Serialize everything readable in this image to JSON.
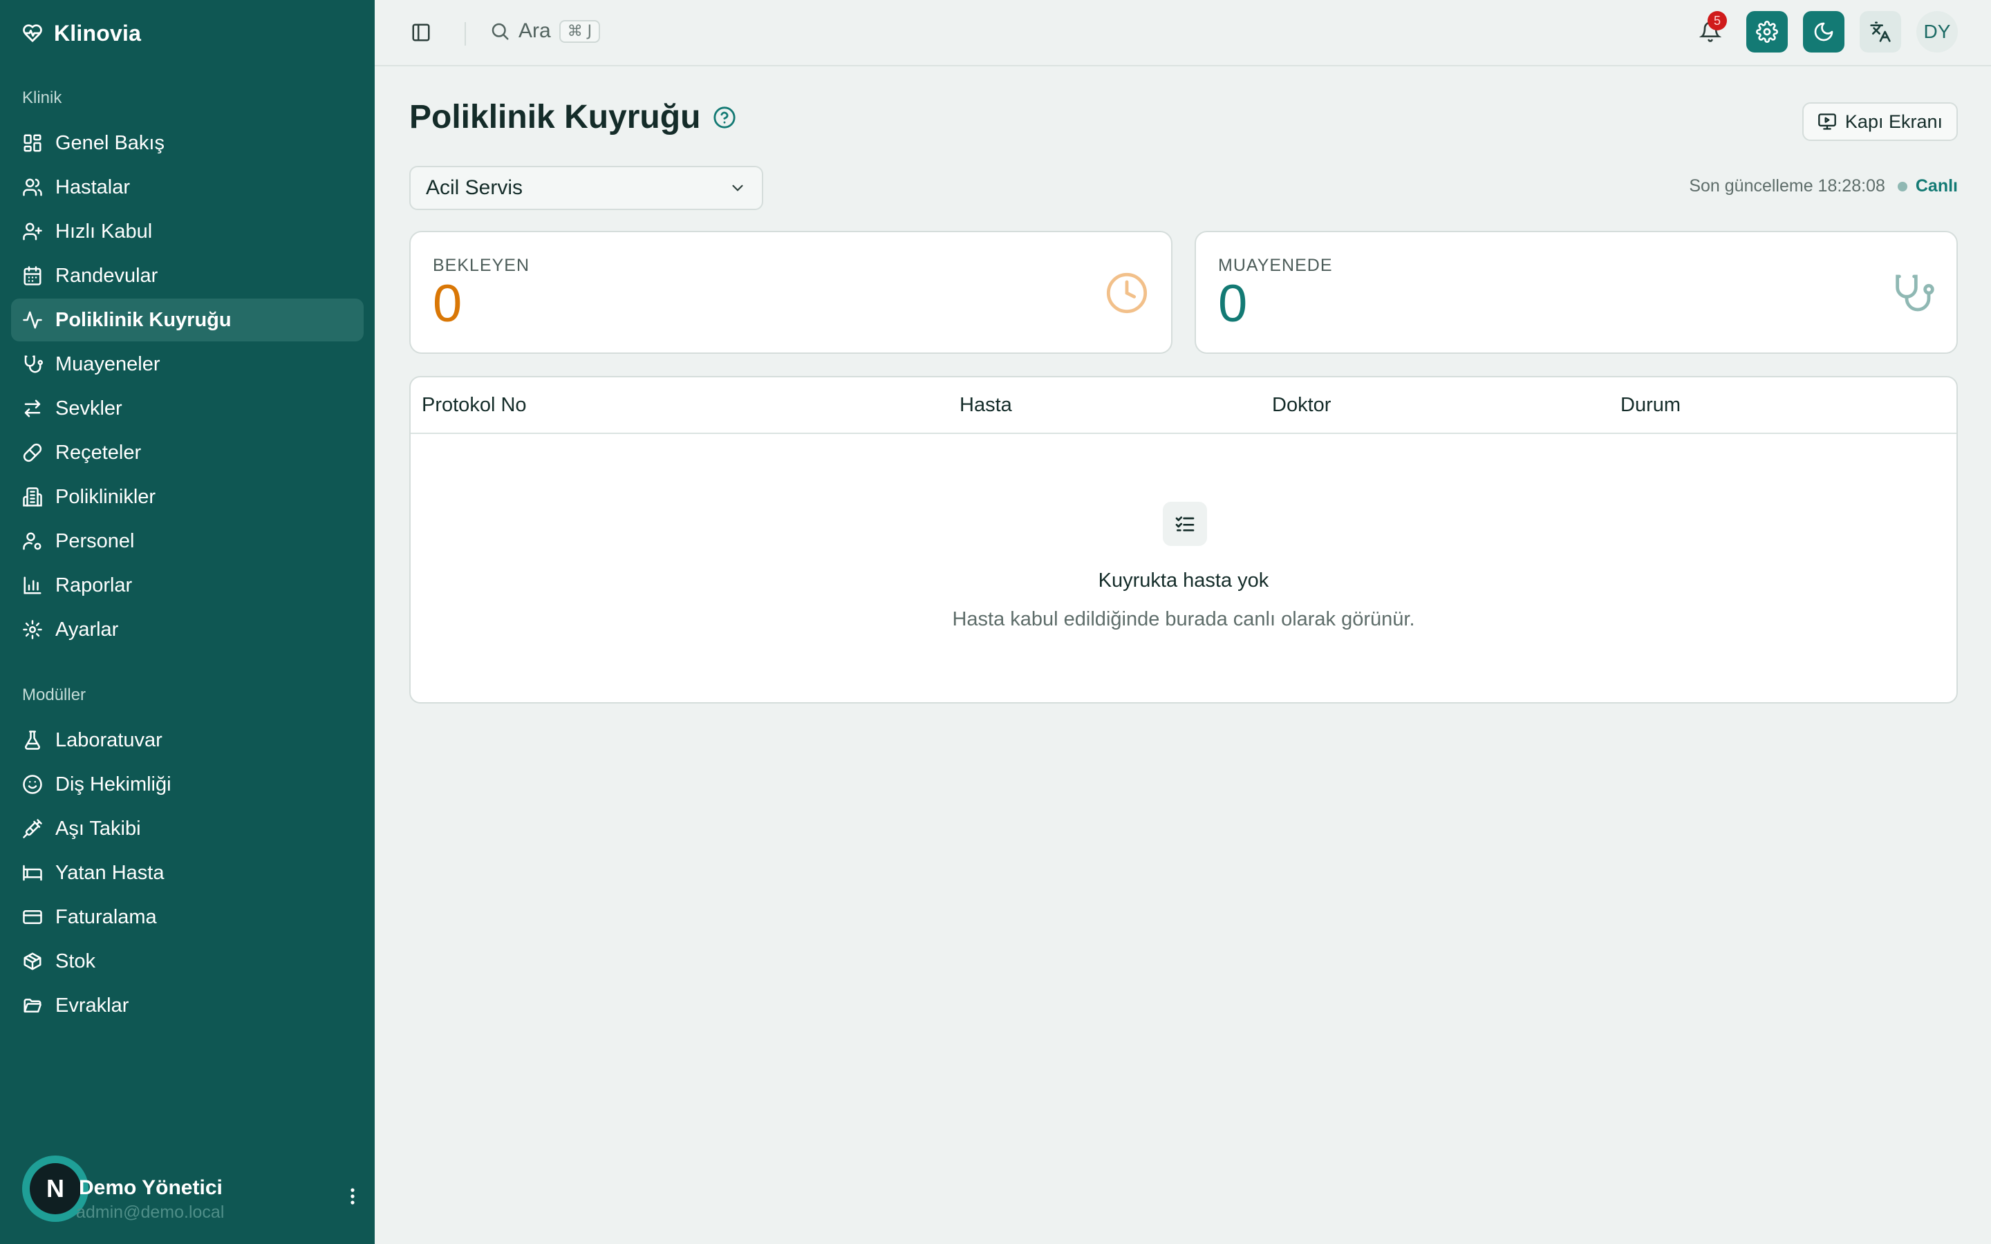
{
  "sidebar": {
    "brand": "Klinovia",
    "section_clinic": "Klinik",
    "clinic_items": [
      {
        "label": "Genel Bakış",
        "icon": "dashboard-icon"
      },
      {
        "label": "Hastalar",
        "icon": "users-icon"
      },
      {
        "label": "Hızlı Kabul",
        "icon": "user-plus-icon"
      },
      {
        "label": "Randevular",
        "icon": "calendar-icon"
      },
      {
        "label": "Poliklinik Kuyruğu",
        "icon": "activity-icon",
        "active": true
      },
      {
        "label": "Muayeneler",
        "icon": "stethoscope-icon"
      },
      {
        "label": "Sevkler",
        "icon": "transfer-icon"
      },
      {
        "label": "Reçeteler",
        "icon": "pill-icon"
      },
      {
        "label": "Poliklinikler",
        "icon": "building-icon"
      },
      {
        "label": "Personel",
        "icon": "user-cog-icon"
      },
      {
        "label": "Raporlar",
        "icon": "bar-chart-icon"
      },
      {
        "label": "Ayarlar",
        "icon": "gear-icon"
      }
    ],
    "section_modules": "Modüller",
    "module_items": [
      {
        "label": "Laboratuvar",
        "icon": "flask-icon"
      },
      {
        "label": "Diş Hekimliği",
        "icon": "smile-icon"
      },
      {
        "label": "Aşı Takibi",
        "icon": "syringe-icon"
      },
      {
        "label": "Yatan Hasta",
        "icon": "bed-icon"
      },
      {
        "label": "Faturalama",
        "icon": "credit-card-icon"
      },
      {
        "label": "Stok",
        "icon": "package-icon"
      },
      {
        "label": "Evraklar",
        "icon": "folder-icon"
      }
    ],
    "user": {
      "avatar_letter": "N",
      "name": "Demo Yönetici",
      "email": "admin@demo.local"
    }
  },
  "topbar": {
    "search_label": "Ara",
    "search_shortcut": "⌘ J",
    "notification_count": "5",
    "avatar_initials": "DY"
  },
  "main": {
    "title": "Poliklinik Kuyruğu",
    "door_button": "Kapı Ekranı",
    "select_value": "Acil Servis",
    "last_update_label": "Son güncelleme 18:28:08",
    "live_label": "Canlı",
    "stats": [
      {
        "label": "BEKLEYEN",
        "value": "0",
        "color": "#d97706"
      },
      {
        "label": "MUAYENEDE",
        "value": "0",
        "color": "#137a74"
      }
    ],
    "table": {
      "columns": [
        "Protokol No",
        "Hasta",
        "Doktor",
        "Durum"
      ],
      "empty_title": "Kuyrukta hasta yok",
      "empty_subtitle": "Hasta kabul edildiğinde burada canlı olarak görünür."
    }
  },
  "colors": {
    "sidebar_bg": "#0f5753",
    "accent": "#137a74",
    "waiting": "#d97706",
    "badge": "#d01b1b"
  }
}
